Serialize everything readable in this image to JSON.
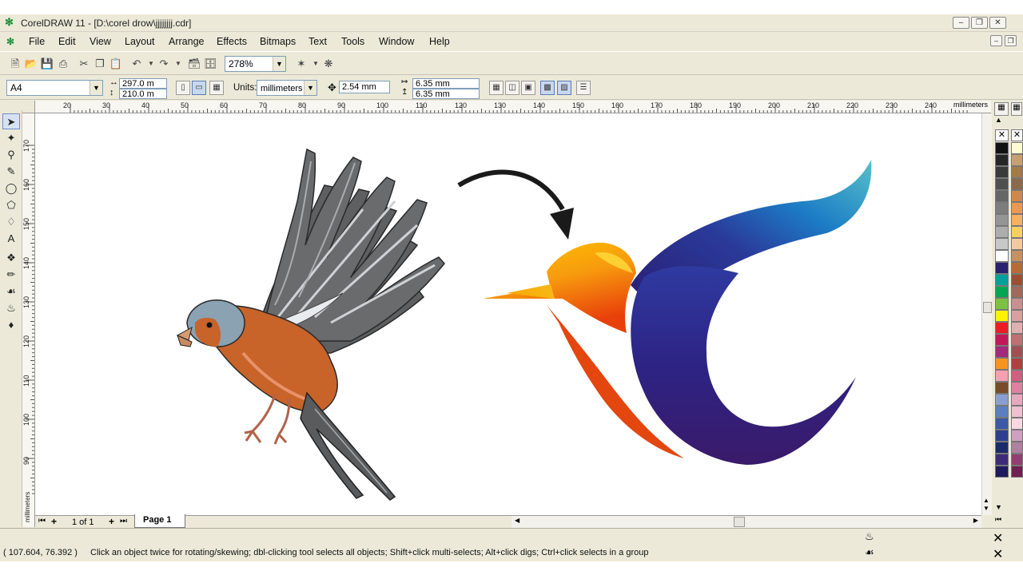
{
  "window": {
    "title": "CorelDRAW 11 - [D:\\corel drow\\jjjjjjjj.cdr]",
    "logo_glyph": "✻"
  },
  "menu": [
    "File",
    "Edit",
    "View",
    "Layout",
    "Arrange",
    "Effects",
    "Bitmaps",
    "Text",
    "Tools",
    "Window",
    "Help"
  ],
  "standard_toolbar": {
    "zoom_value": "278%"
  },
  "property_bar": {
    "paper_size": "A4",
    "width": "297.0 m",
    "height": "210.0 m",
    "units_label": "Units:",
    "units_value": "millimeters",
    "nudge": "2.54 mm",
    "dup_x": "6.35 mm",
    "dup_y": "6.35 mm"
  },
  "rulers": {
    "horizontal_ticks": [
      "20",
      "30",
      "40",
      "50",
      "60",
      "70",
      "80",
      "90",
      "100",
      "110",
      "120",
      "130",
      "140",
      "150",
      "160",
      "170",
      "180",
      "190",
      "200",
      "210",
      "220",
      "230",
      "240"
    ],
    "horizontal_unit": "millimeters",
    "vertical_ticks": [
      "170",
      "160",
      "150",
      "140",
      "130",
      "120",
      "110",
      "100",
      "90"
    ],
    "vertical_unit": "millimeters"
  },
  "page_nav": {
    "counter": "1 of 1",
    "page_tab": "Page 1"
  },
  "status": {
    "coords": "( 107.604, 76.392 )",
    "hint": "Click an object twice for rotating/skewing; dbl-clicking tool selects all objects; Shift+click multi-selects; Alt+click digs; Ctrl+click selects in a group"
  },
  "palette_left": [
    "#111111",
    "#262626",
    "#3a3a3a",
    "#4f4f4f",
    "#666666",
    "#7d7d7d",
    "#959595",
    "#adadad",
    "#c8c8c8",
    "#ffffff",
    "#2a1f6e",
    "#00a09a",
    "#00a651",
    "#7cc242",
    "#fff200",
    "#ed1c24",
    "#c2185b",
    "#a12a7a",
    "#f7941d",
    "#f5a0b0",
    "#7a4a2a",
    "#8b9ed0",
    "#5b7fc0",
    "#3a59a8",
    "#2e3f8f",
    "#1b2a6b",
    "#3d2b7a",
    "#1e1a5e"
  ],
  "palette_right": [
    "#fffbd0",
    "#c8a070",
    "#a47a4a",
    "#8a6a4a",
    "#cc8a4a",
    "#e89a50",
    "#f6b060",
    "#f8d060",
    "#f5c9a0",
    "#c89060",
    "#b86a3a",
    "#9a5030",
    "#a06a5a",
    "#c89090",
    "#d8a0a0",
    "#e0b0b0",
    "#c07070",
    "#a05050",
    "#b04040",
    "#d06080",
    "#e080a0",
    "#e8a8c0",
    "#f0c0d0",
    "#f8d8e0",
    "#d0a0c0",
    "#b080a0",
    "#904070",
    "#702050"
  ],
  "colors": {
    "chrome": "#ece9d8",
    "canvas": "#ffffff",
    "accent_green": "#1a8f3a"
  }
}
